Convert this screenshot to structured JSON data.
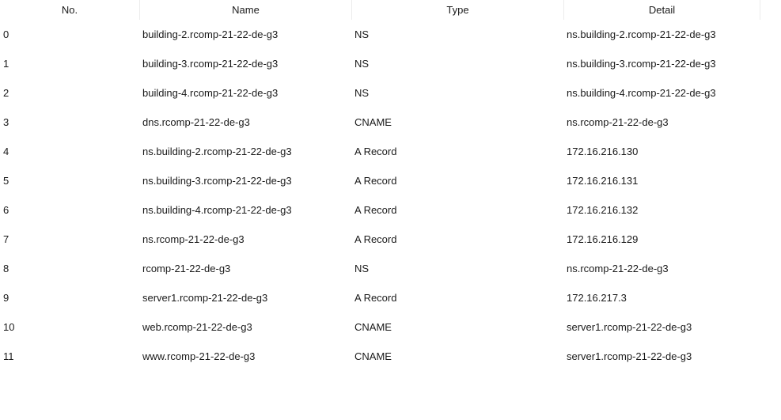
{
  "columns": {
    "no": "No.",
    "name": "Name",
    "type": "Type",
    "detail": "Detail"
  },
  "rows": [
    {
      "no": "0",
      "name": "building-2.rcomp-21-22-de-g3",
      "type": "NS",
      "detail": "ns.building-2.rcomp-21-22-de-g3"
    },
    {
      "no": "1",
      "name": "building-3.rcomp-21-22-de-g3",
      "type": "NS",
      "detail": "ns.building-3.rcomp-21-22-de-g3"
    },
    {
      "no": "2",
      "name": "building-4.rcomp-21-22-de-g3",
      "type": "NS",
      "detail": "ns.building-4.rcomp-21-22-de-g3"
    },
    {
      "no": "3",
      "name": "dns.rcomp-21-22-de-g3",
      "type": "CNAME",
      "detail": "ns.rcomp-21-22-de-g3"
    },
    {
      "no": "4",
      "name": "ns.building-2.rcomp-21-22-de-g3",
      "type": "A Record",
      "detail": "172.16.216.130"
    },
    {
      "no": "5",
      "name": "ns.building-3.rcomp-21-22-de-g3",
      "type": "A Record",
      "detail": "172.16.216.131"
    },
    {
      "no": "6",
      "name": "ns.building-4.rcomp-21-22-de-g3",
      "type": "A Record",
      "detail": "172.16.216.132"
    },
    {
      "no": "7",
      "name": "ns.rcomp-21-22-de-g3",
      "type": "A Record",
      "detail": "172.16.216.129"
    },
    {
      "no": "8",
      "name": "rcomp-21-22-de-g3",
      "type": "NS",
      "detail": "ns.rcomp-21-22-de-g3"
    },
    {
      "no": "9",
      "name": "server1.rcomp-21-22-de-g3",
      "type": "A Record",
      "detail": "172.16.217.3"
    },
    {
      "no": "10",
      "name": "web.rcomp-21-22-de-g3",
      "type": "CNAME",
      "detail": "server1.rcomp-21-22-de-g3"
    },
    {
      "no": "11",
      "name": "www.rcomp-21-22-de-g3",
      "type": "CNAME",
      "detail": "server1.rcomp-21-22-de-g3"
    }
  ]
}
